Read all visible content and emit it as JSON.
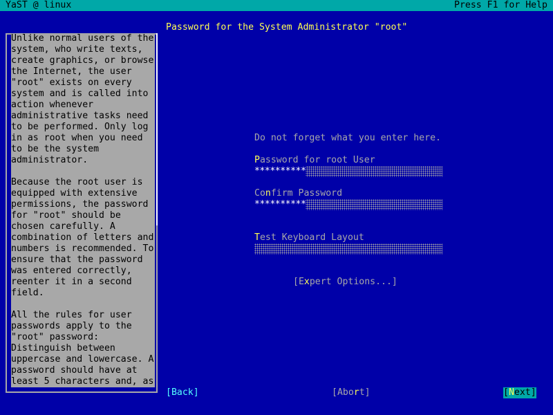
{
  "topbar": {
    "left": "YaST @ linux",
    "right": "Press F1 for Help"
  },
  "help": {
    "paragraphs": [
      "Unlike normal users of the\nsystem, who write texts,\ncreate graphics, or browse\nthe Internet, the user\n\"root\" exists on every\nsystem and is called into\naction whenever\nadministrative tasks need\nto be performed. Only log\nin as root when you need\nto be the system\nadministrator.",
      "Because the root user is\nequipped with extensive\npermissions, the password\nfor \"root\" should be\nchosen carefully. A\ncombination of letters and\nnumbers is recommended. To\nensure that the password\nwas entered correctly,\nreenter it in a second\nfield.",
      "All the rules for user\npasswords apply to the\n\"root\" password:\nDistinguish between\nuppercase and lowercase. A\npassword should have at\nleast 5 characters and, as"
    ]
  },
  "dialog": {
    "title": "Password for the System Administrator \"root\"",
    "hint": "Do not forget what you enter here."
  },
  "fields": {
    "password": {
      "hotkey": "P",
      "label_rest": "assword for root User",
      "value": "**********"
    },
    "confirm": {
      "label_pre": "Co",
      "hotkey": "n",
      "label_rest": "firm Password",
      "value": "**********"
    },
    "keyboard": {
      "hotkey": "T",
      "label_rest": "est Keyboard Layout",
      "value": ""
    }
  },
  "buttons": {
    "expert": {
      "pre": "[E",
      "hotkey": "x",
      "post": "pert Options...]"
    },
    "back": {
      "label": "[Back]"
    },
    "abort": {
      "pre": "[Abo",
      "hotkey": "r",
      "post": "t]"
    },
    "next": {
      "pre": "[",
      "hotkey": "N",
      "post": "ext]"
    }
  }
}
